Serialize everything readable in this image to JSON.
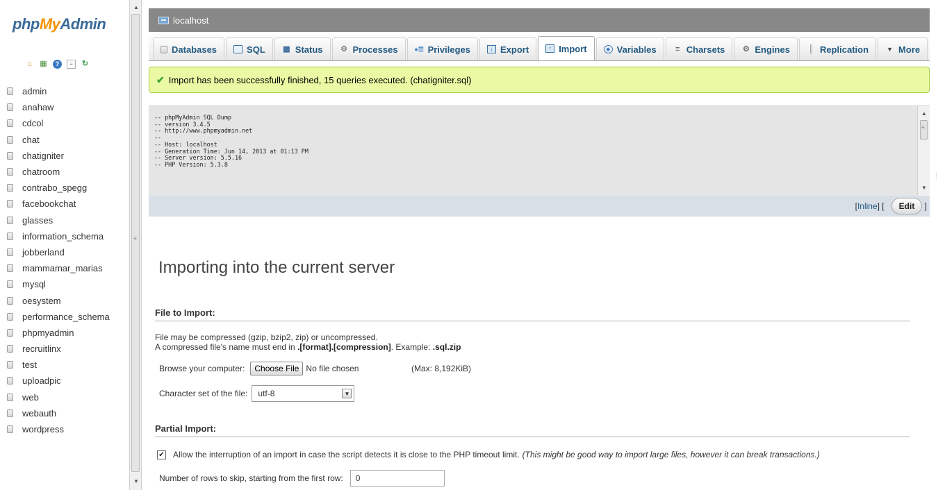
{
  "logo": {
    "php": "php",
    "my": "My",
    "admin": "Admin"
  },
  "nav_icons": [
    "home-icon",
    "sql-query-icon",
    "help-icon",
    "docs-icon",
    "reload-icon"
  ],
  "databases": [
    "admin",
    "anahaw",
    "cdcol",
    "chat",
    "chatigniter",
    "chatroom",
    "contrabo_spegg",
    "facebookchat",
    "glasses",
    "information_schema",
    "jobberland",
    "mammamar_marias",
    "mysql",
    "oesystem",
    "performance_schema",
    "phpmyadmin",
    "recruitlinx",
    "test",
    "uploadpic",
    "web",
    "webauth",
    "wordpress"
  ],
  "server": {
    "name": "localhost"
  },
  "tabs": [
    {
      "label": "Databases",
      "icon": "database-icon"
    },
    {
      "label": "SQL",
      "icon": "sql-icon"
    },
    {
      "label": "Status",
      "icon": "status-icon"
    },
    {
      "label": "Processes",
      "icon": "processes-icon"
    },
    {
      "label": "Privileges",
      "icon": "privileges-icon"
    },
    {
      "label": "Export",
      "icon": "export-icon"
    },
    {
      "label": "Import",
      "icon": "import-icon",
      "active": true
    },
    {
      "label": "Variables",
      "icon": "variables-icon"
    },
    {
      "label": "Charsets",
      "icon": "charsets-icon"
    },
    {
      "label": "Engines",
      "icon": "engines-icon"
    },
    {
      "label": "Replication",
      "icon": "replication-icon"
    },
    {
      "label": "More",
      "icon": "more-icon"
    }
  ],
  "notice": {
    "text": "Import has been successfully finished, 15 queries executed. (chatigniter.sql)"
  },
  "sql_preview": {
    "lines": [
      "-- phpMyAdmin SQL Dump",
      "-- version 3.4.5",
      "-- http://www.phpmyadmin.net",
      "--",
      "-- Host: localhost",
      "-- Generation Time: Jun 14, 2013 at 01:13 PM",
      "-- Server version: 5.5.16",
      "-- PHP Version: 5.3.8"
    ],
    "inline_label": "Inline",
    "edit_label": "Edit"
  },
  "main": {
    "title": "Importing into the current server",
    "file_section": {
      "title": "File to Import:",
      "compress_note": "File may be compressed (gzip, bzip2, zip) or uncompressed.",
      "name_note_prefix": "A compressed file's name must end in ",
      "name_note_format": ".[format].[compression]",
      "name_note_middle": ". Example: ",
      "name_note_example": ".sql.zip",
      "browse_label": "Browse your computer:",
      "choose_button": "Choose File",
      "no_file": "No file chosen",
      "max_size": "(Max: 8,192KiB)",
      "charset_label": "Character set of the file:",
      "charset_value": "utf-8"
    },
    "partial_section": {
      "title": "Partial Import:",
      "interrupt_label": "Allow the interruption of an import in case the script detects it is close to the PHP timeout limit.",
      "interrupt_note": "(This might be good way to import large files, however it can break transactions.)",
      "interrupt_checked": true,
      "skip_label": "Number of rows to skip, starting from the first row:",
      "skip_value": "0"
    }
  }
}
